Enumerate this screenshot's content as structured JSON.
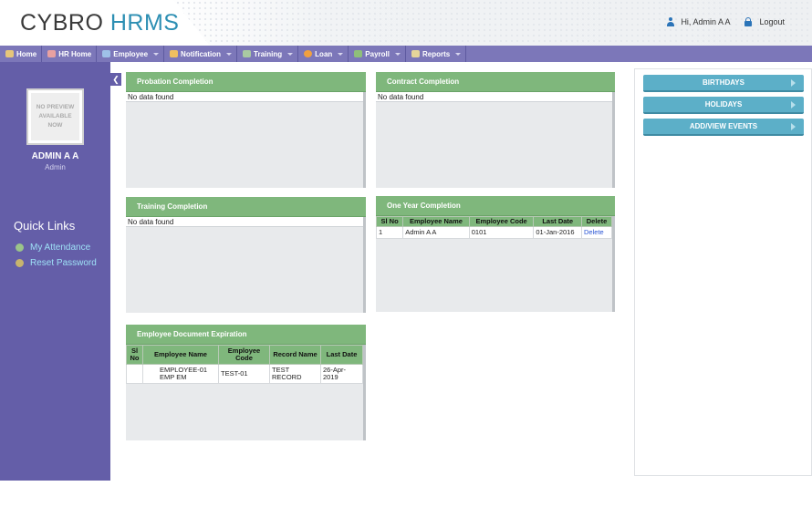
{
  "header": {
    "logo_part1": "CYBRO",
    "logo_part2": "HRMS",
    "greeting": "Hi, Admin A A",
    "logout_label": "Logout"
  },
  "nav": {
    "items": [
      {
        "label": "Home",
        "icon": "home-icon",
        "dropdown": false
      },
      {
        "label": "HR Home",
        "icon": "hr-home-icon",
        "dropdown": false
      },
      {
        "label": "Employee",
        "icon": "employee-icon",
        "dropdown": true
      },
      {
        "label": "Notification",
        "icon": "notification-icon",
        "dropdown": true
      },
      {
        "label": "Training",
        "icon": "training-icon",
        "dropdown": true
      },
      {
        "label": "Loan",
        "icon": "loan-icon",
        "dropdown": true
      },
      {
        "label": "Payroll",
        "icon": "payroll-icon",
        "dropdown": true
      },
      {
        "label": "Reports",
        "icon": "reports-icon",
        "dropdown": true
      }
    ]
  },
  "sidebar": {
    "preview_text": "NO PREVIEW AVAILABLE NOW",
    "user_name": "ADMIN A A",
    "user_role": "Admin",
    "quick_links_title": "Quick Links",
    "quick_links": [
      {
        "label": "My Attendance",
        "color": "#9bc48a"
      },
      {
        "label": "Reset Password",
        "color": "#c8b46e"
      }
    ]
  },
  "panels": {
    "probation": {
      "title": "Probation Completion",
      "empty_text": "No data found"
    },
    "contract": {
      "title": "Contract Completion",
      "empty_text": "No data found"
    },
    "training": {
      "title": "Training Completion",
      "empty_text": "No data found"
    },
    "one_year": {
      "title": "One Year Completion",
      "columns": [
        "Sl No",
        "Employee Name",
        "Employee Code",
        "Last Date",
        "Delete"
      ],
      "rows": [
        {
          "sl_no": "1",
          "employee_name": "Admin A A",
          "employee_code": "0101",
          "last_date": "01-Jan-2016",
          "delete_label": "Delete"
        }
      ]
    },
    "doc_expiration": {
      "title": "Employee Document Expiration",
      "columns": [
        "Sl No",
        "Employee Name",
        "Employee Code",
        "Record Name",
        "Last Date"
      ],
      "rows": [
        {
          "sl_no": "",
          "employee_name": "EMPLOYEE-01 EMP EM",
          "employee_code": "TEST-01",
          "record_name": "TEST RECORD",
          "last_date": "26-Apr-2019"
        }
      ]
    }
  },
  "right": {
    "buttons": [
      "BIRTHDAYS",
      "HOLIDAYS",
      "ADD/VIEW EVENTS"
    ]
  },
  "colors": {
    "nav": "#7c77b9",
    "sidebar": "#645ea8",
    "panel_header": "#7fb77c",
    "right_button": "#5cafc8",
    "accent_blue": "#2d8fb3"
  }
}
